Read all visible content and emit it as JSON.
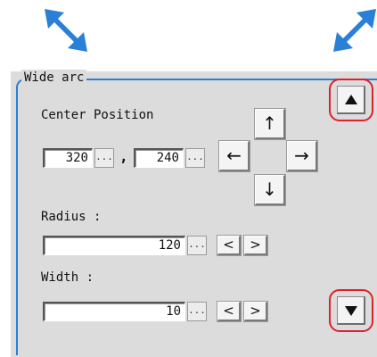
{
  "panel": {
    "legend": "Wide arc",
    "center_position_label": "Center Position",
    "center_x": "320",
    "center_y": "240",
    "comma": ",",
    "radius_label": "Radius :",
    "radius_value": "120",
    "width_label": "Width :",
    "width_value": "10",
    "ellipsis": "...",
    "dir_up": "↑",
    "dir_down": "↓",
    "dir_left": "←",
    "dir_right": "→",
    "step_dec": "<",
    "step_inc": ">"
  },
  "icons": {
    "top_left": "diagonal-resize-nwse-icon",
    "top_right": "diagonal-resize-nesw-icon",
    "scroll_up": "triangle-up-icon",
    "scroll_down": "triangle-down-icon"
  },
  "colors": {
    "accent_blue": "#2a7fd6",
    "highlight_red": "#e0202a",
    "panel_bg": "#dcdcdc"
  }
}
